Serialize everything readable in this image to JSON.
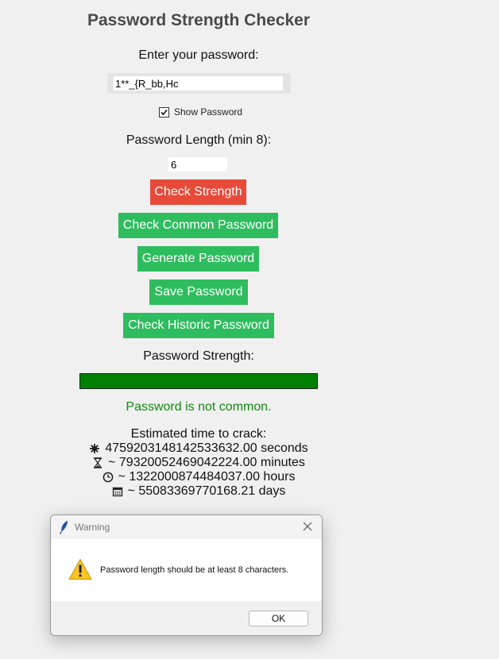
{
  "app": {
    "title": "Password Strength Checker",
    "enter_password_label": "Enter your password:",
    "password_value": "1**_{R_bb,Hc",
    "show_password_label": "Show Password",
    "show_password_checked": true,
    "length_label": "Password Length (min 8):",
    "length_value": "6",
    "buttons": {
      "check_strength": "Check Strength",
      "check_common": "Check Common Password",
      "generate": "Generate Password",
      "save": "Save Password",
      "check_historic": "Check Historic Password"
    },
    "strength_label": "Password Strength:",
    "strength_level": 1.0,
    "common_status": "Password is not common.",
    "crack_heading": "Estimated time to crack:",
    "crack_times": {
      "seconds": "4759203148142533632.00 seconds",
      "minutes": "~ 79320052469042224.00 minutes",
      "hours": "~ 1322000874484037.00 hours",
      "days": "~ 55083369770168.21 days"
    }
  },
  "colors": {
    "check_strength_button": "#e84a3a",
    "green_buttons": "#2ebd5e",
    "strength_bar": "#008000",
    "common_status_text": "#118a11"
  },
  "dialog": {
    "title": "Warning",
    "message": "Password length should be at least 8 characters.",
    "ok_label": "OK",
    "icons": [
      "feather-icon",
      "warning-icon",
      "close-icon"
    ]
  }
}
